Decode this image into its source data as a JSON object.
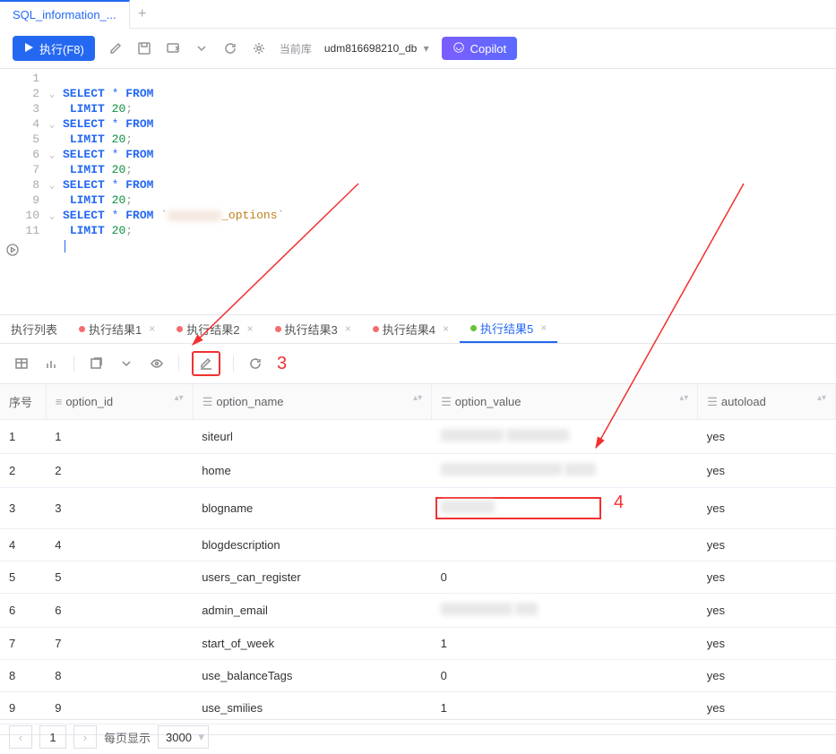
{
  "top_tab": {
    "label": "SQL_information_..."
  },
  "toolbar": {
    "run_label": "执行(F8)",
    "db_label": "当前库",
    "db_name": "udm816698210_db",
    "copilot_label": "Copilot"
  },
  "editor": {
    "lines": [
      {
        "n": 1,
        "text": ""
      },
      {
        "n": 2,
        "fold": true,
        "kw1": "SELECT",
        "star": "*",
        "kw2": "FROM"
      },
      {
        "n": 3,
        "indent": " ",
        "kw": "LIMIT",
        "num": "20",
        "semi": ";"
      },
      {
        "n": 4,
        "fold": true,
        "kw1": "SELECT",
        "star": "*",
        "kw2": "FROM"
      },
      {
        "n": 5,
        "indent": " ",
        "kw": "LIMIT",
        "num": "20",
        "semi": ";"
      },
      {
        "n": 6,
        "fold": true,
        "kw1": "SELECT",
        "star": "*",
        "kw2": "FROM"
      },
      {
        "n": 7,
        "indent": " ",
        "kw": "LIMIT",
        "num": "20",
        "semi": ";"
      },
      {
        "n": 8,
        "fold": true,
        "kw1": "SELECT",
        "star": "*",
        "kw2": "FROM"
      },
      {
        "n": 9,
        "indent": " ",
        "kw": "LIMIT",
        "num": "20",
        "semi": ";"
      },
      {
        "n": 10,
        "fold": true,
        "kw1": "SELECT",
        "star": "*",
        "kw2": "FROM",
        "tick": "`",
        "blur": true,
        "suffix": "_options",
        "tick2": "`"
      },
      {
        "n": 11,
        "indent": " ",
        "kw": "LIMIT",
        "num": "20",
        "semi": ";"
      }
    ]
  },
  "result_tabs": {
    "list_tab": "执行列表",
    "tabs": [
      {
        "label": "执行结果1",
        "status": "red"
      },
      {
        "label": "执行结果2",
        "status": "red"
      },
      {
        "label": "执行结果3",
        "status": "red"
      },
      {
        "label": "执行结果4",
        "status": "red"
      },
      {
        "label": "执行结果5",
        "status": "green",
        "active": true
      }
    ]
  },
  "table": {
    "columns": {
      "seq": "序号",
      "option_id": "option_id",
      "option_name": "option_name",
      "option_value": "option_value",
      "autoload": "autoload"
    },
    "rows": [
      {
        "seq": "1",
        "option_id": "1",
        "option_name": "siteurl",
        "option_value": "",
        "autoload": "yes",
        "blur_w1": 70,
        "blur_w2": 70
      },
      {
        "seq": "2",
        "option_id": "2",
        "option_name": "home",
        "option_value": "",
        "autoload": "yes",
        "blur_w1": 135,
        "blur_w2": 35
      },
      {
        "seq": "3",
        "option_id": "3",
        "option_name": "blogname",
        "option_value": "",
        "autoload": "yes",
        "blur_w1": 60,
        "redbox": true
      },
      {
        "seq": "4",
        "option_id": "4",
        "option_name": "blogdescription",
        "option_value": "",
        "autoload": "yes"
      },
      {
        "seq": "5",
        "option_id": "5",
        "option_name": "users_can_register",
        "option_value": "0",
        "autoload": "yes"
      },
      {
        "seq": "6",
        "option_id": "6",
        "option_name": "admin_email",
        "option_value": "",
        "autoload": "yes",
        "blur_w1": 80,
        "blur_w2": 25
      },
      {
        "seq": "7",
        "option_id": "7",
        "option_name": "start_of_week",
        "option_value": "1",
        "autoload": "yes"
      },
      {
        "seq": "8",
        "option_id": "8",
        "option_name": "use_balanceTags",
        "option_value": "0",
        "autoload": "yes"
      },
      {
        "seq": "9",
        "option_id": "9",
        "option_name": "use_smilies",
        "option_value": "1",
        "autoload": "yes"
      }
    ]
  },
  "pager": {
    "page": "1",
    "per_page_label": "每页显示",
    "per_page_value": "3000"
  },
  "annotations": {
    "label3": "3",
    "label4": "4"
  }
}
